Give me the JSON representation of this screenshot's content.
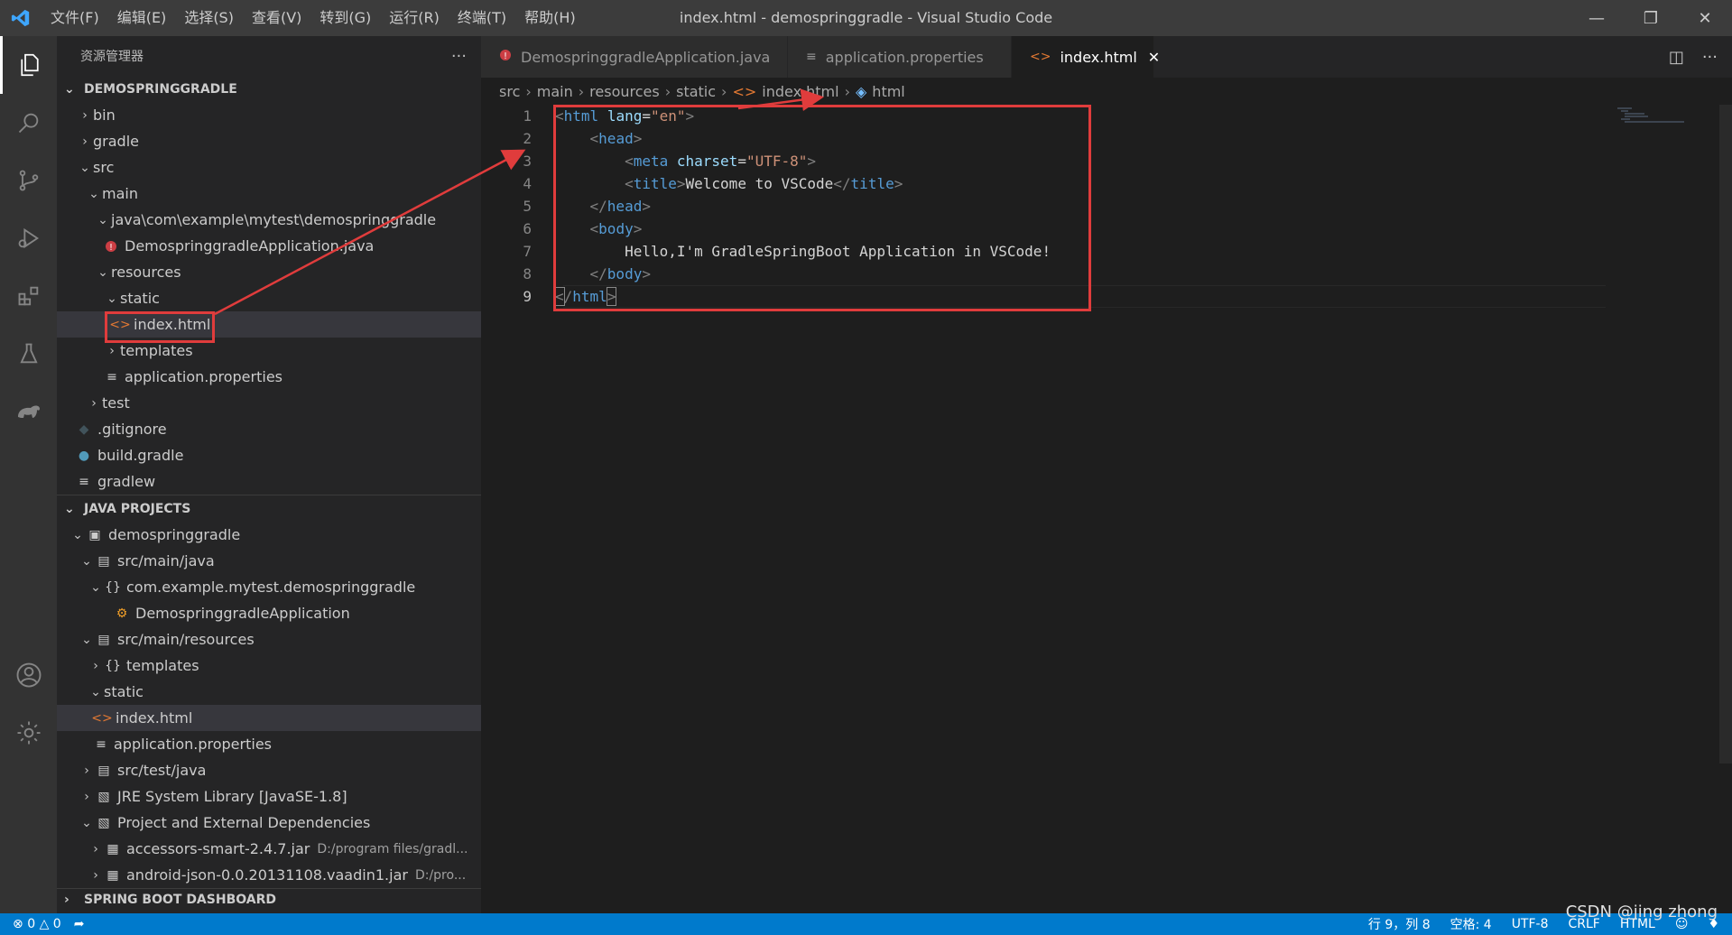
{
  "window": {
    "title": "index.html - demospringgradle - Visual Studio Code",
    "menu": [
      "文件(F)",
      "编辑(E)",
      "选择(S)",
      "查看(V)",
      "转到(G)",
      "运行(R)",
      "终端(T)",
      "帮助(H)"
    ]
  },
  "activity_bar": [
    "explorer-icon",
    "search-icon",
    "source-control-icon",
    "run-debug-icon",
    "extensions-icon",
    "testing-icon",
    "gradle-icon",
    "account-icon",
    "settings-gear-icon"
  ],
  "sidebar": {
    "title": "资源管理器",
    "more": "···",
    "workspace": "DEMOSPRINGGRADLE",
    "tree": [
      {
        "label": "bin"
      },
      {
        "label": "gradle"
      },
      {
        "label": "src"
      },
      {
        "label": "main"
      },
      {
        "label": "java\\com\\example\\mytest\\demospringgradle"
      },
      {
        "label": "DemospringgradleApplication.java"
      },
      {
        "label": "resources"
      },
      {
        "label": "static"
      },
      {
        "label": "index.html"
      },
      {
        "label": "templates"
      },
      {
        "label": "application.properties"
      },
      {
        "label": "test"
      },
      {
        "label": ".gitignore"
      },
      {
        "label": "build.gradle"
      },
      {
        "label": "gradlew"
      }
    ],
    "java_projects": {
      "title": "JAVA PROJECTS",
      "items": [
        {
          "label": "demospringgradle"
        },
        {
          "label": "src/main/java"
        },
        {
          "label": "com.example.mytest.demospringgradle"
        },
        {
          "label": "DemospringgradleApplication"
        },
        {
          "label": "src/main/resources"
        },
        {
          "label": "templates"
        },
        {
          "label": "static"
        },
        {
          "label": "index.html"
        },
        {
          "label": "application.properties"
        },
        {
          "label": "src/test/java"
        },
        {
          "label": "JRE System Library [JavaSE-1.8]"
        },
        {
          "label": "Project and External Dependencies"
        },
        {
          "label": "accessors-smart-2.4.7.jar",
          "desc": "D:/program files/gradl..."
        },
        {
          "label": "android-json-0.0.20131108.vaadin1.jar",
          "desc": "D:/pro..."
        }
      ]
    },
    "spring_boot": "SPRING BOOT DASHBOARD"
  },
  "tabs": [
    {
      "label": "DemospringgradleApplication.java"
    },
    {
      "label": "application.properties"
    },
    {
      "label": "index.html",
      "close": "✕"
    }
  ],
  "breadcrumb": [
    "src",
    "main",
    "resources",
    "static",
    "index.html",
    "html"
  ],
  "code": {
    "line_numbers": [
      "1",
      "2",
      "3",
      "4",
      "5",
      "6",
      "7",
      "8",
      "9"
    ],
    "l1_lang_attr": "lang",
    "l1_lang_val": "\"en\"",
    "l3_attr": "charset",
    "l3_val": "\"UTF-8\"",
    "l4_text": "Welcome to VSCode",
    "l7_text": "Hello,I'm GradleSpringBoot Application in VSCode!",
    "tag_html": "html",
    "tag_head": "head",
    "tag_meta": "meta",
    "tag_title": "title",
    "tag_body": "body"
  },
  "status": {
    "errors": "0",
    "warnings": "0",
    "position": "行 9，列 8",
    "spaces": "空格: 4",
    "encoding": "UTF-8",
    "eol": "CRLF",
    "language": "HTML"
  },
  "watermark": "CSDN @jing zhong",
  "colors": {
    "accent": "#007acc",
    "annotation": "#e03c3c",
    "html_icon": "#e37933",
    "java_icon": "#cc3e44"
  }
}
